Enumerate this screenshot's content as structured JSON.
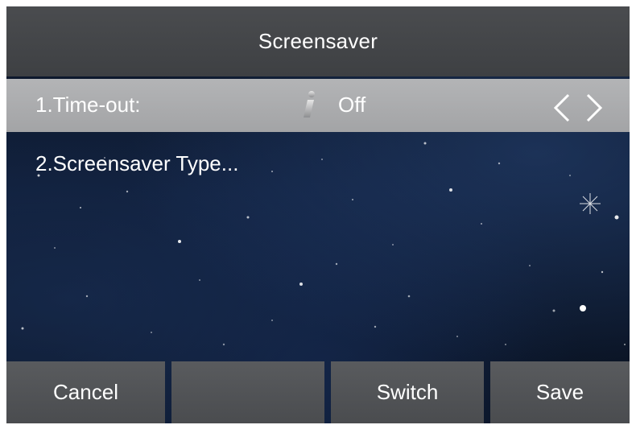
{
  "header": {
    "title": "Screensaver"
  },
  "menu": {
    "items": [
      {
        "label": "1.Time-out:",
        "value": "Off",
        "icon": "info-icon"
      },
      {
        "label": "2.Screensaver Type..."
      }
    ]
  },
  "softkeys": [
    {
      "label": "Cancel"
    },
    {
      "label": ""
    },
    {
      "label": "Switch"
    },
    {
      "label": "Save"
    }
  ],
  "colors": {
    "title_bar": "#45474a",
    "selected_row": "#aaabad",
    "softkey": "#525457",
    "background": "#0d1930",
    "text": "#ffffff"
  }
}
